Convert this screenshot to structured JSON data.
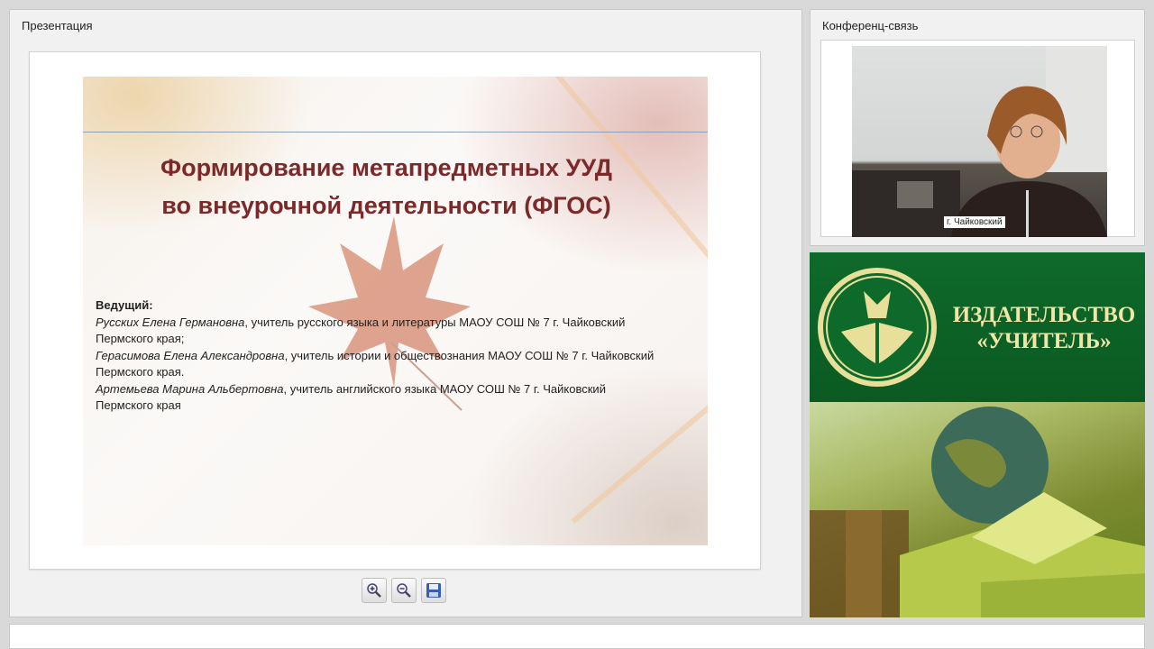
{
  "presentation": {
    "title": "Презентация",
    "slide": {
      "title": "Формирование метапредметных УУД\nво внеурочной деятельности (ФГОС)",
      "host_label": "Ведущий:",
      "presenters": [
        {
          "name": "Русских Елена Германовна",
          "role": ", учитель русского языка и литературы МАОУ СОШ № 7 г. Чайковский",
          "region": "Пермского края;"
        },
        {
          "name": "Герасимова Елена Александровна",
          "role": ", учитель истории и обществознания МАОУ СОШ № 7 г. Чайковский",
          "region": "Пермского края."
        },
        {
          "name": "Артемьева Марина Альбертовна",
          "role": ", учитель английского языка МАОУ СОШ № 7 г. Чайковский",
          "region": "Пермского края"
        }
      ]
    },
    "toolbar": [
      "zoom-in-icon",
      "zoom-out-icon",
      "save-icon"
    ]
  },
  "conference": {
    "title": "Конференц-связь",
    "video_label": "г. Чайковский"
  },
  "ad": {
    "title": "ИЗДАТЕЛЬСТВО\n«УЧИТЕЛЬ»",
    "colors": {
      "background": "#0e6a2b",
      "text": "#f0e6a8"
    }
  }
}
